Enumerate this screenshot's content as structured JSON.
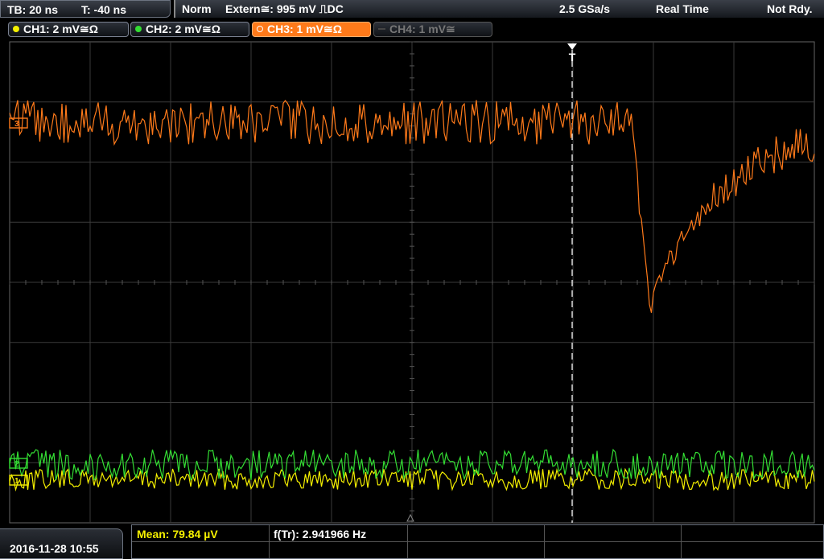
{
  "timebase": {
    "tb": "TB: 20 ns",
    "trigger_time": "T: -40 ns"
  },
  "status": {
    "mode": "Norm",
    "trigger": "Extern≅: 995 mV ⎍DC",
    "sample_rate": "2.5 GSa/s",
    "acq_mode": "Real Time",
    "state": "Not Rdy."
  },
  "channels": [
    {
      "label": "CH1: 2 mV≅Ω",
      "color": "#f5f000"
    },
    {
      "label": "CH2: 2 mV≅Ω",
      "color": "#33dd33"
    },
    {
      "label": "CH3: 1 mV≅Ω",
      "color": "#ff7a1a"
    },
    {
      "label": "CH4: 1 mV≅",
      "color": "#666666"
    }
  ],
  "trigger_marker": {
    "label": "T"
  },
  "markers": {
    "ch1": "1",
    "ch2": "2",
    "ch3": "3"
  },
  "datetime": "2016-11-28 10:55",
  "measurements": [
    {
      "label": "Mean: 79.84 µV",
      "color": "#f5f000"
    },
    {
      "label": "f(Tr): 2.941966 Hz",
      "color": "#ffffff"
    }
  ],
  "colors": {
    "grid": "#3a3a3a",
    "background": "#000000",
    "accent": "#ff7a1a"
  }
}
